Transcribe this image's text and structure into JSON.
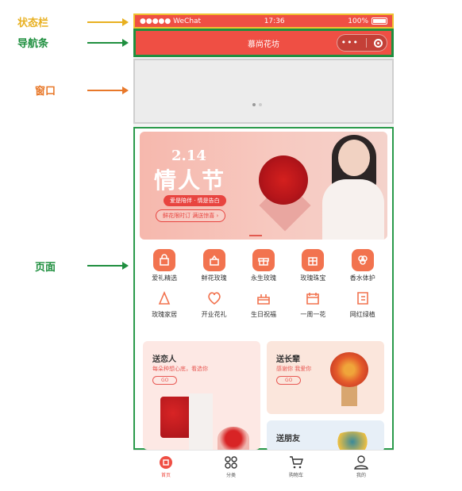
{
  "annotations": {
    "status_bar": "状态栏",
    "nav_bar": "导航条",
    "window": "窗口",
    "page": "页面"
  },
  "status_bar": {
    "carrier": "●●●●● WeChat",
    "time": "17:36",
    "battery": "100%"
  },
  "nav": {
    "title": "慕尚花坊",
    "menu_icon": "ellipsis-icon",
    "close_icon": "target-icon"
  },
  "banner": {
    "date": "2.14",
    "title": "情人节",
    "subtitle": "爱是陪伴 · 情是告白",
    "button": "鲜花限时订 满送惊喜 ›"
  },
  "categories": [
    {
      "label": "爱礼精选"
    },
    {
      "label": "鲜花玫瑰"
    },
    {
      "label": "永生玫瑰"
    },
    {
      "label": "玫瑰珠宝"
    },
    {
      "label": "香水体护"
    },
    {
      "label": "玫瑰家居"
    },
    {
      "label": "开业花礼"
    },
    {
      "label": "生日祝福"
    },
    {
      "label": "一周一花"
    },
    {
      "label": "网红绿植"
    }
  ],
  "cards": {
    "love": {
      "title": "送恋人",
      "subtitle": "每朵种想心底，看选你",
      "go": "GO"
    },
    "elder": {
      "title": "送长辈",
      "subtitle": "感谢你 我爱你",
      "go": "GO"
    },
    "friend": {
      "title": "送朋友"
    }
  },
  "tabs": [
    {
      "label": "首页",
      "icon": "home-flower-icon",
      "active": true
    },
    {
      "label": "分类",
      "icon": "grid-icon"
    },
    {
      "label": "购物车",
      "icon": "cart-icon"
    },
    {
      "label": "我的",
      "icon": "user-icon"
    }
  ],
  "colors": {
    "brand": "#ef4f44",
    "icon_orange": "#f2734f",
    "status_outline": "#f0c030",
    "nav_outline": "#1f8f3f",
    "page_outline": "#2a9a4a"
  }
}
